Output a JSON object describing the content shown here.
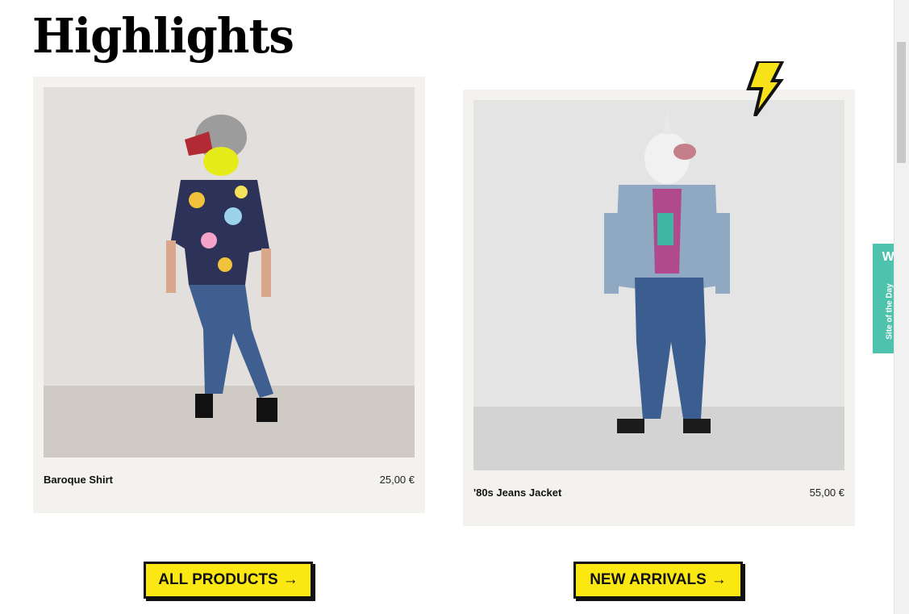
{
  "section": {
    "title": "Highlights"
  },
  "products": [
    {
      "name": "Baroque Shirt",
      "price": "25,00 €"
    },
    {
      "name": "'80s Jeans Jacket",
      "price": "55,00 €"
    }
  ],
  "buttons": {
    "all_products": "ALL PRODUCTS",
    "new_arrivals": "NEW ARRIVALS",
    "arrow": "→"
  },
  "badge": {
    "letter": "W.",
    "text": "Site of the Day"
  },
  "colors": {
    "button_bg": "#fbe813",
    "card_bg": "#f3f2ef",
    "badge_bg": "#4ec2ac",
    "bolt": "#f7e21a"
  }
}
